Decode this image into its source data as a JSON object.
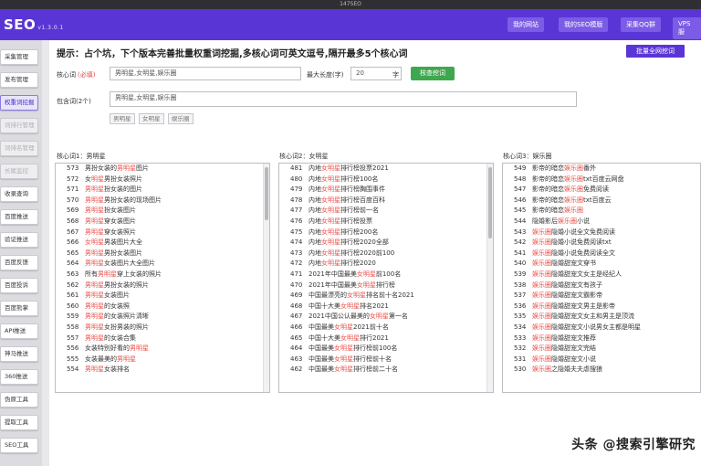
{
  "os": {
    "title": "147SEO"
  },
  "app": {
    "brand": "SEO",
    "version": "v1.3.0.1"
  },
  "topnav": [
    {
      "label": "我的网站"
    },
    {
      "label": "我的SEO模版"
    },
    {
      "label": "采集QQ群"
    },
    {
      "label": "VPS服"
    }
  ],
  "sidebar": {
    "items": [
      {
        "label": "采集管理",
        "state": "normal"
      },
      {
        "label": "发布管理",
        "state": "normal"
      },
      {
        "label": "权重词挖掘",
        "state": "active"
      },
      {
        "label": "词排行管理",
        "state": "disabled"
      },
      {
        "label": "词排名管理",
        "state": "disabled"
      },
      {
        "label": "长尾监控",
        "state": "disabled"
      },
      {
        "label": "收录查询",
        "state": "normal"
      },
      {
        "label": "百度推送",
        "state": "normal"
      },
      {
        "label": "验证推送",
        "state": "normal"
      },
      {
        "label": "百度反馈",
        "state": "normal"
      },
      {
        "label": "百度投诉",
        "state": "normal"
      },
      {
        "label": "百度熊掌",
        "state": "normal"
      },
      {
        "label": "API推送",
        "state": "normal"
      },
      {
        "label": "神马推送",
        "state": "normal"
      },
      {
        "label": "360推送",
        "state": "normal"
      },
      {
        "label": "伪原工具",
        "state": "normal"
      },
      {
        "label": "提取工具",
        "state": "normal"
      },
      {
        "label": "SEO工具",
        "state": "normal"
      }
    ]
  },
  "main": {
    "hint": "提示：占个坑，下个版本完善批量权重词挖掘,多核心词可英文逗号,隔开最多5个核心词",
    "batch_button": "批量全网挖词",
    "core_label": "核心词",
    "core_required": "(必填)",
    "core_value": "男明星,女明星,娱乐圈",
    "maxlen_label": "最大长度(字)",
    "maxlen_value": "20",
    "maxlen_unit": "字",
    "dig_button": "核查挖词",
    "include_label": "包含词(2个)",
    "include_value": "男明星,女明星,娱乐圈",
    "tags": [
      "男明星",
      "女明星",
      "娱乐圈"
    ]
  },
  "columns": [
    {
      "title": "核心词1：男明星",
      "rows": [
        {
          "num": "573",
          "pre": "男扮女装的",
          "kw": "男明星",
          "post": "图片"
        },
        {
          "num": "572",
          "pre": "女",
          "kw": "明星",
          "post": "男扮女装照片"
        },
        {
          "num": "571",
          "pre": "",
          "kw": "男明星",
          "post": "扮女装的图片"
        },
        {
          "num": "570",
          "pre": "",
          "kw": "男明星",
          "post": "男扮女装的现场图片"
        },
        {
          "num": "569",
          "pre": "",
          "kw": "男明星",
          "post": "扮女装图片"
        },
        {
          "num": "568",
          "pre": "",
          "kw": "男明星",
          "post": "穿女装图片"
        },
        {
          "num": "567",
          "pre": "",
          "kw": "男明星",
          "post": "穿女装照片"
        },
        {
          "num": "566",
          "pre": "",
          "kw": "女明星",
          "post": "男装图片大全"
        },
        {
          "num": "565",
          "pre": "",
          "kw": "男明星",
          "post": "男扮女装图片"
        },
        {
          "num": "564",
          "pre": "",
          "kw": "男明星",
          "post": "女装图片大全图片"
        },
        {
          "num": "563",
          "pre": "所有",
          "kw": "男明星",
          "post": "穿上女装的照片"
        },
        {
          "num": "562",
          "pre": "",
          "kw": "男明星",
          "post": "男扮女装的照片"
        },
        {
          "num": "561",
          "pre": "",
          "kw": "男明星",
          "post": "女装图片"
        },
        {
          "num": "560",
          "pre": "",
          "kw": "男明星",
          "post": "的女装照"
        },
        {
          "num": "559",
          "pre": "",
          "kw": "男明星",
          "post": "的女装照片清晰"
        },
        {
          "num": "558",
          "pre": "",
          "kw": "男明星",
          "post": "女扮男装的照片"
        },
        {
          "num": "557",
          "pre": "",
          "kw": "男明星",
          "post": "的女装合集"
        },
        {
          "num": "556",
          "pre": "女装特别好看的",
          "kw": "男明星",
          "post": ""
        },
        {
          "num": "555",
          "pre": "女装最美的",
          "kw": "男明星",
          "post": ""
        },
        {
          "num": "554",
          "pre": "",
          "kw": "男明星",
          "post": "女装排名"
        }
      ]
    },
    {
      "title": "核心词2：女明星",
      "rows": [
        {
          "num": "481",
          "pre": "内地",
          "kw": "女明星",
          "post": "排行榜投票2021"
        },
        {
          "num": "480",
          "pre": "内地",
          "kw": "女明星",
          "post": "排行榜100名"
        },
        {
          "num": "479",
          "pre": "内地",
          "kw": "女明星",
          "post": "排行榜胸围事件"
        },
        {
          "num": "478",
          "pre": "内地",
          "kw": "女明星",
          "post": "排行榜百度百科"
        },
        {
          "num": "477",
          "pre": "内地",
          "kw": "女明星",
          "post": "排行榜前一名"
        },
        {
          "num": "476",
          "pre": "内地",
          "kw": "女明星",
          "post": "排行榜投票"
        },
        {
          "num": "475",
          "pre": "内地",
          "kw": "女明星",
          "post": "排行榜200名"
        },
        {
          "num": "474",
          "pre": "内地",
          "kw": "女明星",
          "post": "排行榜2020全部"
        },
        {
          "num": "473",
          "pre": "内地",
          "kw": "女明星",
          "post": "排行榜2020前100"
        },
        {
          "num": "472",
          "pre": "内地",
          "kw": "女明星",
          "post": "排行榜2020"
        },
        {
          "num": "471",
          "pre": "2021年中国最美",
          "kw": "女明星",
          "post": "前100名"
        },
        {
          "num": "470",
          "pre": "2021年中国最美",
          "kw": "女明星",
          "post": "排行榜"
        },
        {
          "num": "469",
          "pre": "中国最漂亮的",
          "kw": "女明星",
          "post": "排名前十名2021"
        },
        {
          "num": "468",
          "pre": "中国十大美",
          "kw": "女明星",
          "post": "排名2021"
        },
        {
          "num": "467",
          "pre": "2021中国公认最美的",
          "kw": "女明星",
          "post": "第一名"
        },
        {
          "num": "466",
          "pre": "中国最美",
          "kw": "女明星",
          "post": "2021前十名"
        },
        {
          "num": "465",
          "pre": "中国十大美",
          "kw": "女明星",
          "post": "排行2021"
        },
        {
          "num": "464",
          "pre": "中国最美",
          "kw": "女明星",
          "post": "排行榜前100名"
        },
        {
          "num": "463",
          "pre": "中国最美",
          "kw": "女明星",
          "post": "排行榜前十名"
        },
        {
          "num": "462",
          "pre": "中国最美",
          "kw": "女明星",
          "post": "排行榜前二十名"
        }
      ]
    },
    {
      "title": "核心词3：娱乐圈",
      "rows": [
        {
          "num": "549",
          "pre": "影帝的暗恋",
          "kw": "娱乐圈",
          "post": "番外"
        },
        {
          "num": "548",
          "pre": "影帝的暗恋",
          "kw": "娱乐圈",
          "post": "txt百度云网盘"
        },
        {
          "num": "547",
          "pre": "影帝的暗恋",
          "kw": "娱乐圈",
          "post": "免费阅读"
        },
        {
          "num": "546",
          "pre": "影帝的暗恋",
          "kw": "娱乐圈",
          "post": "txt百度云"
        },
        {
          "num": "545",
          "pre": "影帝的暗恋",
          "kw": "娱乐圈",
          "post": ""
        },
        {
          "num": "544",
          "pre": "隐婚影后",
          "kw": "娱乐圈",
          "post": "小说"
        },
        {
          "num": "543",
          "pre": "",
          "kw": "娱乐圈",
          "post": "隐婚小说全文免费阅读"
        },
        {
          "num": "542",
          "pre": "",
          "kw": "娱乐圈",
          "post": "隐婚小说免费阅读txt"
        },
        {
          "num": "541",
          "pre": "",
          "kw": "娱乐圈",
          "post": "隐婚小说免费阅读全文"
        },
        {
          "num": "540",
          "pre": "",
          "kw": "娱乐圈",
          "post": "隐婚甜宠文穿书"
        },
        {
          "num": "539",
          "pre": "",
          "kw": "娱乐圈",
          "post": "隐婚甜宠文女主是经纪人"
        },
        {
          "num": "538",
          "pre": "",
          "kw": "娱乐圈",
          "post": "隐婚甜宠文有孩子"
        },
        {
          "num": "537",
          "pre": "",
          "kw": "娱乐圈",
          "post": "隐婚甜宠文霸影帝"
        },
        {
          "num": "536",
          "pre": "",
          "kw": "娱乐圈",
          "post": "隐婚甜宠文男主是影帝"
        },
        {
          "num": "535",
          "pre": "",
          "kw": "娱乐圈",
          "post": "隐婚甜宠文女主和男主是顶流"
        },
        {
          "num": "534",
          "pre": "",
          "kw": "娱乐圈",
          "post": "隐婚甜宠文小说男女主都是明星"
        },
        {
          "num": "533",
          "pre": "",
          "kw": "娱乐圈",
          "post": "隐婚甜宠文推荐"
        },
        {
          "num": "532",
          "pre": "",
          "kw": "娱乐圈",
          "post": "隐婚甜宠文完结"
        },
        {
          "num": "531",
          "pre": "",
          "kw": "娱乐圈",
          "post": "隐婚甜宠文小说"
        },
        {
          "num": "530",
          "pre": "",
          "kw": "娱乐圈",
          "post": "之隐婚夫夫虐搜狼"
        }
      ]
    }
  ],
  "watermark": "头条 @搜索引擎研究",
  "colors": {
    "brand": "#5a35d6",
    "keyword": "#e8504a",
    "green": "#3fa74e"
  }
}
